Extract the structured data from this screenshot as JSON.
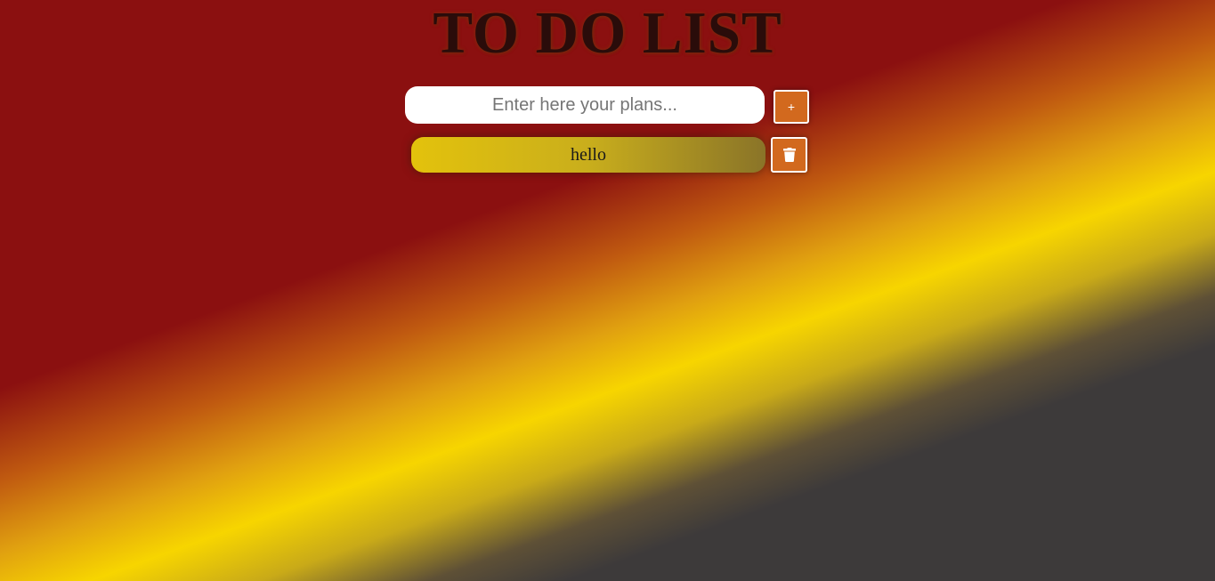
{
  "header": {
    "title": "TO DO LIST"
  },
  "input": {
    "placeholder": "Enter here your plans...",
    "value": ""
  },
  "add_button": {
    "label": "+"
  },
  "todos": [
    {
      "text": "hello",
      "delete_icon": "trash-icon"
    }
  ],
  "colors": {
    "accent": "#d2691e",
    "title": "#2a0c0a",
    "gradient": [
      "#8b1010",
      "#f7d500",
      "#3d3a3a"
    ]
  }
}
